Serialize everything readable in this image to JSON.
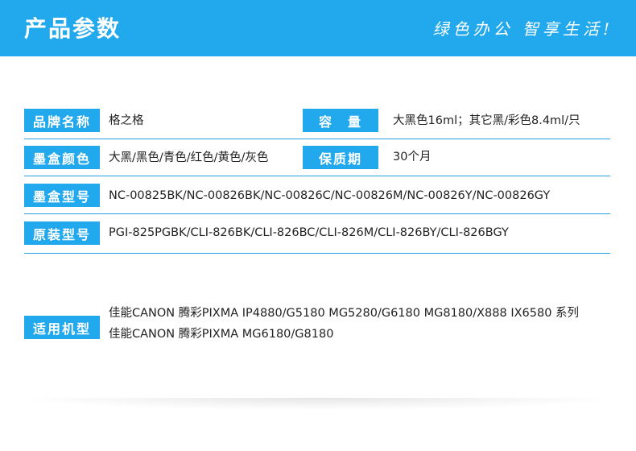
{
  "header": {
    "title": "产品参数",
    "slogan": "绿色办公 智享生活!"
  },
  "rows": {
    "brand": {
      "label": "品牌名称",
      "value": "格之格"
    },
    "capacity": {
      "label": "容　量",
      "value": "大黑色16ml；其它黑/彩色8.4ml/只"
    },
    "colors": {
      "label": "墨盒颜色",
      "value": "大黑/黑色/青色/红色/黄色/灰色"
    },
    "warranty": {
      "label": "保质期",
      "value": "30个月"
    },
    "model": {
      "label": "墨盒型号",
      "value": "NC-00825BK/NC-00826BK/NC-00826C/NC-00826M/NC-00826Y/NC-00826GY"
    },
    "original": {
      "label": "原装型号",
      "value": "PGI-825PGBK/CLI-826BK/CLI-826BC/CLI-826M/CLI-826BY/CLI-826BGY"
    },
    "compat": {
      "label": "适用机型",
      "line1": "佳能CANON 腾彩PIXMA IP4880/G5180 MG5280/G6180 MG8180/X888 IX6580 系列",
      "line2": "佳能CANON 腾彩PIXMA MG6180/G8180"
    }
  },
  "colors": {
    "accent": "#22a8ec",
    "rule": "#2aa0e0",
    "text": "#222222"
  }
}
